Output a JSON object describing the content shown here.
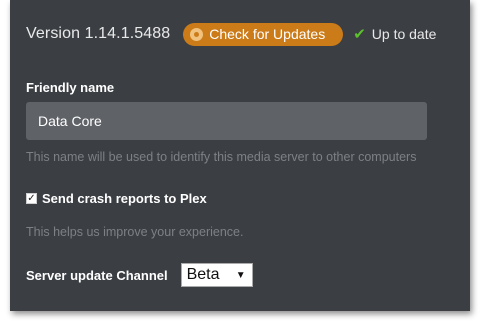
{
  "header": {
    "version": "Version 1.14.1.5488",
    "check_updates_label": "Check for Updates",
    "status_label": "Up to date"
  },
  "friendly_name": {
    "label": "Friendly name",
    "value": "Data Core",
    "help": "This name will be used to identify this media server to other computers"
  },
  "crash_reports": {
    "label": "Send crash reports to Plex",
    "checked": true,
    "help": "This helps us improve your experience."
  },
  "update_channel": {
    "label": "Server update Channel",
    "selected": "Beta"
  },
  "colors": {
    "panel_bg": "#3b3f44",
    "accent_orange": "#cc7b19",
    "success_green": "#5cc12c",
    "input_bg": "#5f6267",
    "muted_text": "#7d8085"
  },
  "icons": {
    "update_button": "update-circle-icon",
    "status": "check-icon",
    "select": "chevron-down-icon"
  }
}
